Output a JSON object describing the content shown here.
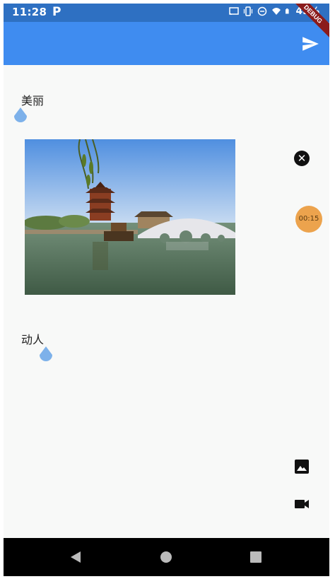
{
  "status_bar": {
    "time": "11:28",
    "app_icon": "P",
    "battery_text": "45%",
    "icons": [
      "cast-icon",
      "vibrate-icon",
      "dnd-icon",
      "wifi-icon",
      "battery-icon"
    ]
  },
  "debug_banner": "DEBUG",
  "app_bar": {
    "action_icon": "send-icon",
    "color": "#3f8cf0"
  },
  "content": {
    "items": [
      {
        "text": "美丽"
      },
      {
        "text": "动人"
      }
    ],
    "timer_text": "00:15",
    "timer_color": "#eca34d"
  },
  "tools": {
    "image_icon": "image-icon",
    "video_icon": "videocam-icon"
  },
  "nav_bar": {
    "icons": [
      "back-icon",
      "home-icon",
      "recents-icon"
    ]
  }
}
